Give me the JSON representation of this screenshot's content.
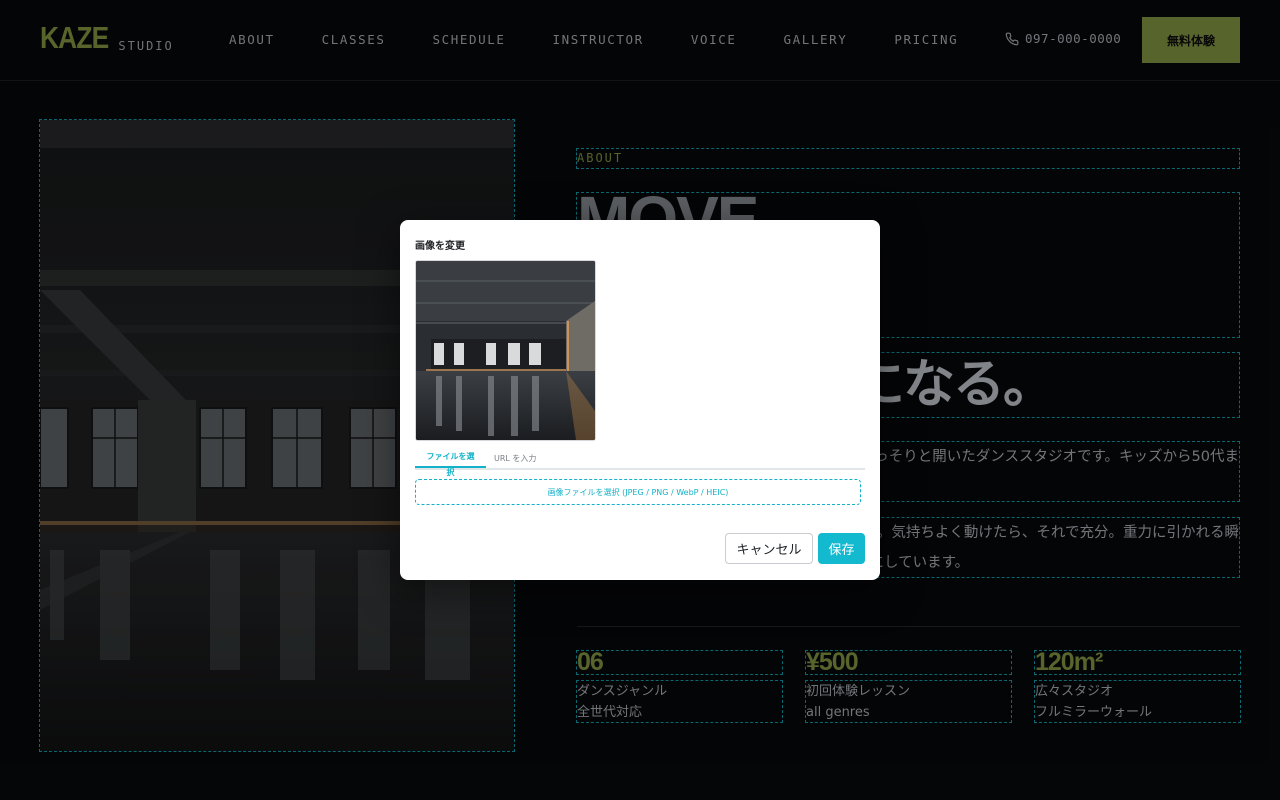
{
  "header": {
    "logo": "KAZE",
    "logo_sub": "STUDIO",
    "nav": [
      "ABOUT",
      "CLASSES",
      "SCHEDULE",
      "INSTRUCTOR",
      "VOICE",
      "GALLERY",
      "PRICING"
    ],
    "phone": "097-000-0000",
    "phone_icon": "phone-icon",
    "cta": "無料体験"
  },
  "about": {
    "label": "ABOUT",
    "headline_en": "MOVE",
    "headline_jp": "になる。",
    "para1": "っそりと開いたダンススタジオです。キッズから50代ま",
    "para2_line1": "い。気持ちよく動けたら、それで充分。重力に引かれる瞬",
    "para2_line2": "切にしています。"
  },
  "stats": [
    {
      "num": "06",
      "line1": "ダンスジャンル",
      "line2": "全世代対応"
    },
    {
      "num": "¥500",
      "line1": "初回体験レッスン",
      "line2": "all genres"
    },
    {
      "num": "120m²",
      "line1": "広々スタジオ",
      "line2": "フルミラーウォール"
    }
  ],
  "modal": {
    "title": "画像を変更",
    "tab_file": "ファイルを選択",
    "tab_url": "URL を入力",
    "dropzone": "画像ファイルを選択 (JPEG / PNG / WebP / HEIC)",
    "cancel": "キャンセル",
    "save": "保存"
  },
  "colors": {
    "accent": "#6b7a35",
    "modal_accent": "#13b9cf",
    "edit_outline": "#0e7f8c",
    "background": "#060709"
  }
}
